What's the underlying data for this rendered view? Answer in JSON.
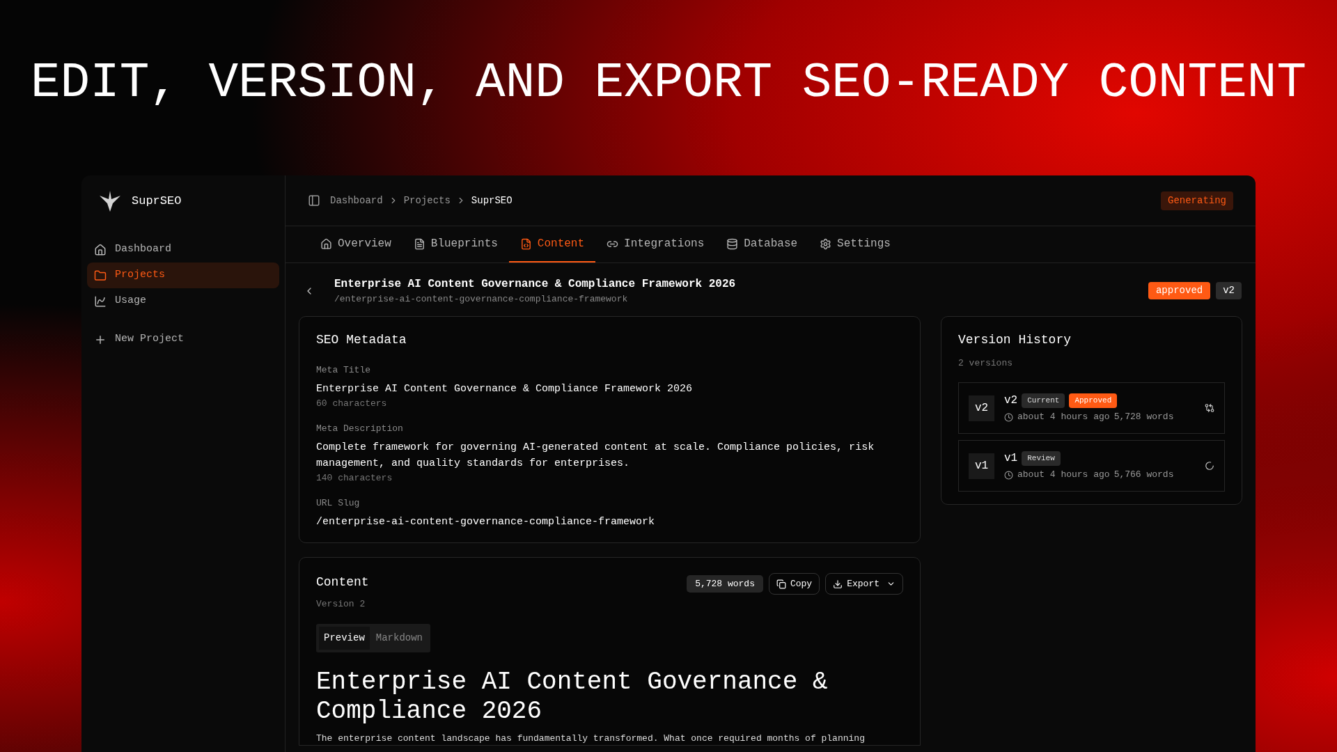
{
  "headline": "EDIT, VERSION, AND EXPORT SEO-READY CONTENT",
  "app": {
    "name": "SuprSEO"
  },
  "sidebar": {
    "items": [
      {
        "label": "Dashboard",
        "selected": false
      },
      {
        "label": "Projects",
        "selected": true
      },
      {
        "label": "Usage",
        "selected": false
      }
    ],
    "new_project": "New Project"
  },
  "breadcrumbs": [
    {
      "label": "Dashboard",
      "current": false
    },
    {
      "label": "Projects",
      "current": false
    },
    {
      "label": "SuprSEO",
      "current": true
    }
  ],
  "status_badge": "Generating",
  "tabs": [
    {
      "label": "Overview",
      "selected": false
    },
    {
      "label": "Blueprints",
      "selected": false
    },
    {
      "label": "Content",
      "selected": true
    },
    {
      "label": "Integrations",
      "selected": false
    },
    {
      "label": "Database",
      "selected": false
    },
    {
      "label": "Settings",
      "selected": false
    }
  ],
  "page": {
    "title": "Enterprise AI Content Governance & Compliance Framework 2026",
    "slug": "/enterprise-ai-content-governance-compliance-framework",
    "status": "approved",
    "version": "v2"
  },
  "seo": {
    "title": "SEO Metadata",
    "fields": [
      {
        "label": "Meta Title",
        "value": "Enterprise AI Content Governance & Compliance Framework 2026",
        "count": "60 characters"
      },
      {
        "label": "Meta Description",
        "value": "Complete framework for governing AI-generated content at scale. Compliance policies, risk management, and quality standards for enterprises.",
        "count": "140 characters"
      },
      {
        "label": "URL Slug",
        "value": "/enterprise-ai-content-governance-compliance-framework"
      }
    ]
  },
  "versions": {
    "title": "Version History",
    "count": "2 versions",
    "items": [
      {
        "badge": "v2",
        "name": "v2",
        "tags": [
          {
            "label": "Current",
            "kind": "neutral"
          },
          {
            "label": "Approved",
            "kind": "accent"
          }
        ],
        "time": "about 4 hours ago",
        "words": "5,728 words",
        "kind": "restore"
      },
      {
        "badge": "v1",
        "name": "v1",
        "tags": [
          {
            "label": "Review",
            "kind": "neutral"
          }
        ],
        "time": "about 4 hours ago",
        "words": "5,766 words",
        "kind": "pending"
      }
    ]
  },
  "content": {
    "title": "Content",
    "subtitle": "Version 2",
    "word_count": "5,728 words",
    "copy": "Copy",
    "export": "Export",
    "view_tabs": [
      {
        "label": "Preview",
        "selected": true
      },
      {
        "label": "Markdown",
        "selected": false
      }
    ],
    "heading": "Enterprise AI Content Governance & Compliance 2026",
    "body": "The enterprise content landscape has fundamentally transformed. What once required months of planning"
  }
}
